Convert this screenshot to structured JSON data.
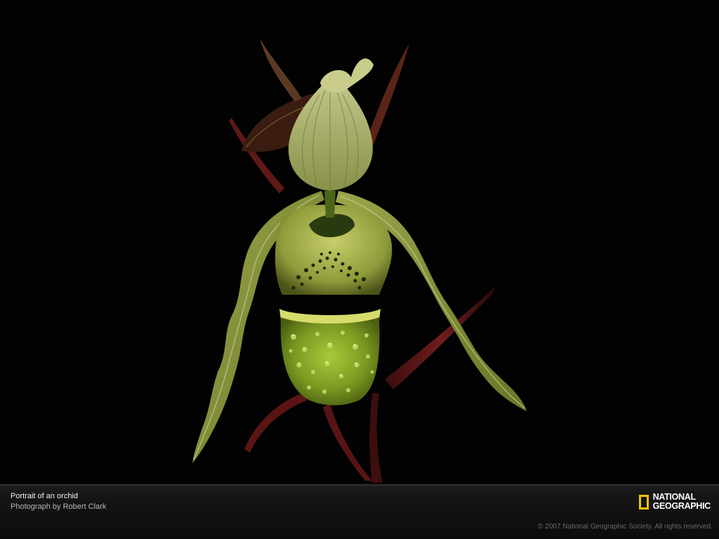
{
  "photo": {
    "subject": "orchid-flower"
  },
  "caption": {
    "title": "Portrait of an orchid",
    "credit": "Photograph by Robert Clark"
  },
  "brand": {
    "line1": "NATIONAL",
    "line2": "GEOGRAPHIC",
    "accent_color": "#f2c200"
  },
  "footer": {
    "copyright": "© 2007 National Geographic Society. All rights reserved."
  }
}
